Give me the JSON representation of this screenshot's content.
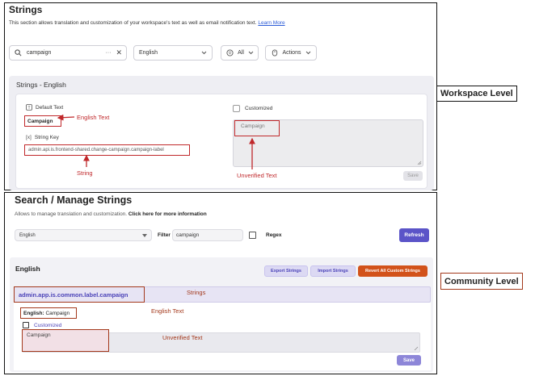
{
  "workspace": {
    "title": "Strings",
    "description": "This section allows translation and customization of your workspace's text as well as email notification text.",
    "learn_more": "Learn More",
    "search": {
      "value": "campaign",
      "more": "···",
      "clear": "✕"
    },
    "language_select": "English",
    "filter_select": "All",
    "actions_select": "Actions",
    "section_title": "Strings - English",
    "default_text_label": "Default Text",
    "default_text_value": "Campaign",
    "string_key_label": "String Key",
    "string_key_value": "admin.api.is.frontend-shared.change-campaign.campaign-label",
    "customized_label": "Customized",
    "unverified_value": "Campaign",
    "save": "Save"
  },
  "workspace_annotations": {
    "english_text": "English Text",
    "string": "String",
    "unverified_text": "Unverified Text",
    "level_label": "Workspace Level"
  },
  "community": {
    "title": "Search / Manage Strings",
    "description": "Allows to manage translation and customization.",
    "more_info": "Click here for more information",
    "language_select": "English",
    "filter_label": "Filter",
    "filter_value": "campaign",
    "regex_label": "Regex",
    "refresh": "Refresh",
    "section_title": "English",
    "export": "Export Strings",
    "import": "Import Strings",
    "revert": "Revert All Custom Strings",
    "string_key": "admin.app.is.common.label.campaign",
    "english_label": "English:",
    "english_value": "Campaign",
    "customized_label": "Customized",
    "unverified_value": "Campaign",
    "save": "Save"
  },
  "community_annotations": {
    "strings": "Strings",
    "english_text": "English Text",
    "unverified_text": "Unverified Text",
    "level_label": "Community Level"
  },
  "colors": {
    "annotation_red": "#c0282b",
    "annotation_brown": "#a3381b",
    "primary": "#5b54c8",
    "revert": "#d2521a"
  }
}
